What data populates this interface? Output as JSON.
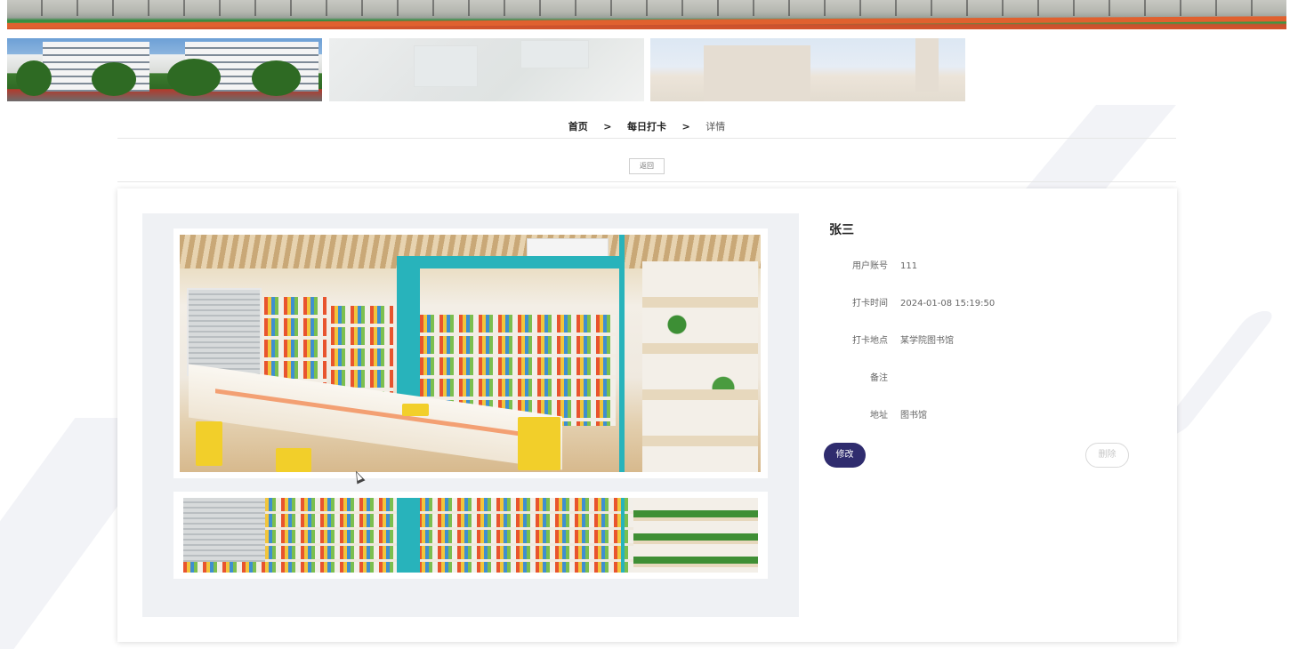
{
  "breadcrumb": {
    "home": "首页",
    "separator": ">",
    "checkin": "每日打卡",
    "detail": "详情"
  },
  "actions": {
    "back": "返回",
    "edit": "修改",
    "delete": "删除"
  },
  "detail": {
    "name": "张三",
    "fields": [
      {
        "label": "用户账号",
        "value": "111"
      },
      {
        "label": "打卡时间",
        "value": "2024-01-08 15:19:50"
      },
      {
        "label": "打卡地点",
        "value": "某学院图书馆"
      },
      {
        "label": "备注",
        "value": ""
      },
      {
        "label": "地址",
        "value": "图书馆"
      }
    ]
  },
  "colors": {
    "primary": "#2f2c6e",
    "gallery_bg": "#eff1f4",
    "accent_teal": "#28b3bb"
  },
  "icons": {
    "cursor": "mouse-pointer-icon"
  }
}
